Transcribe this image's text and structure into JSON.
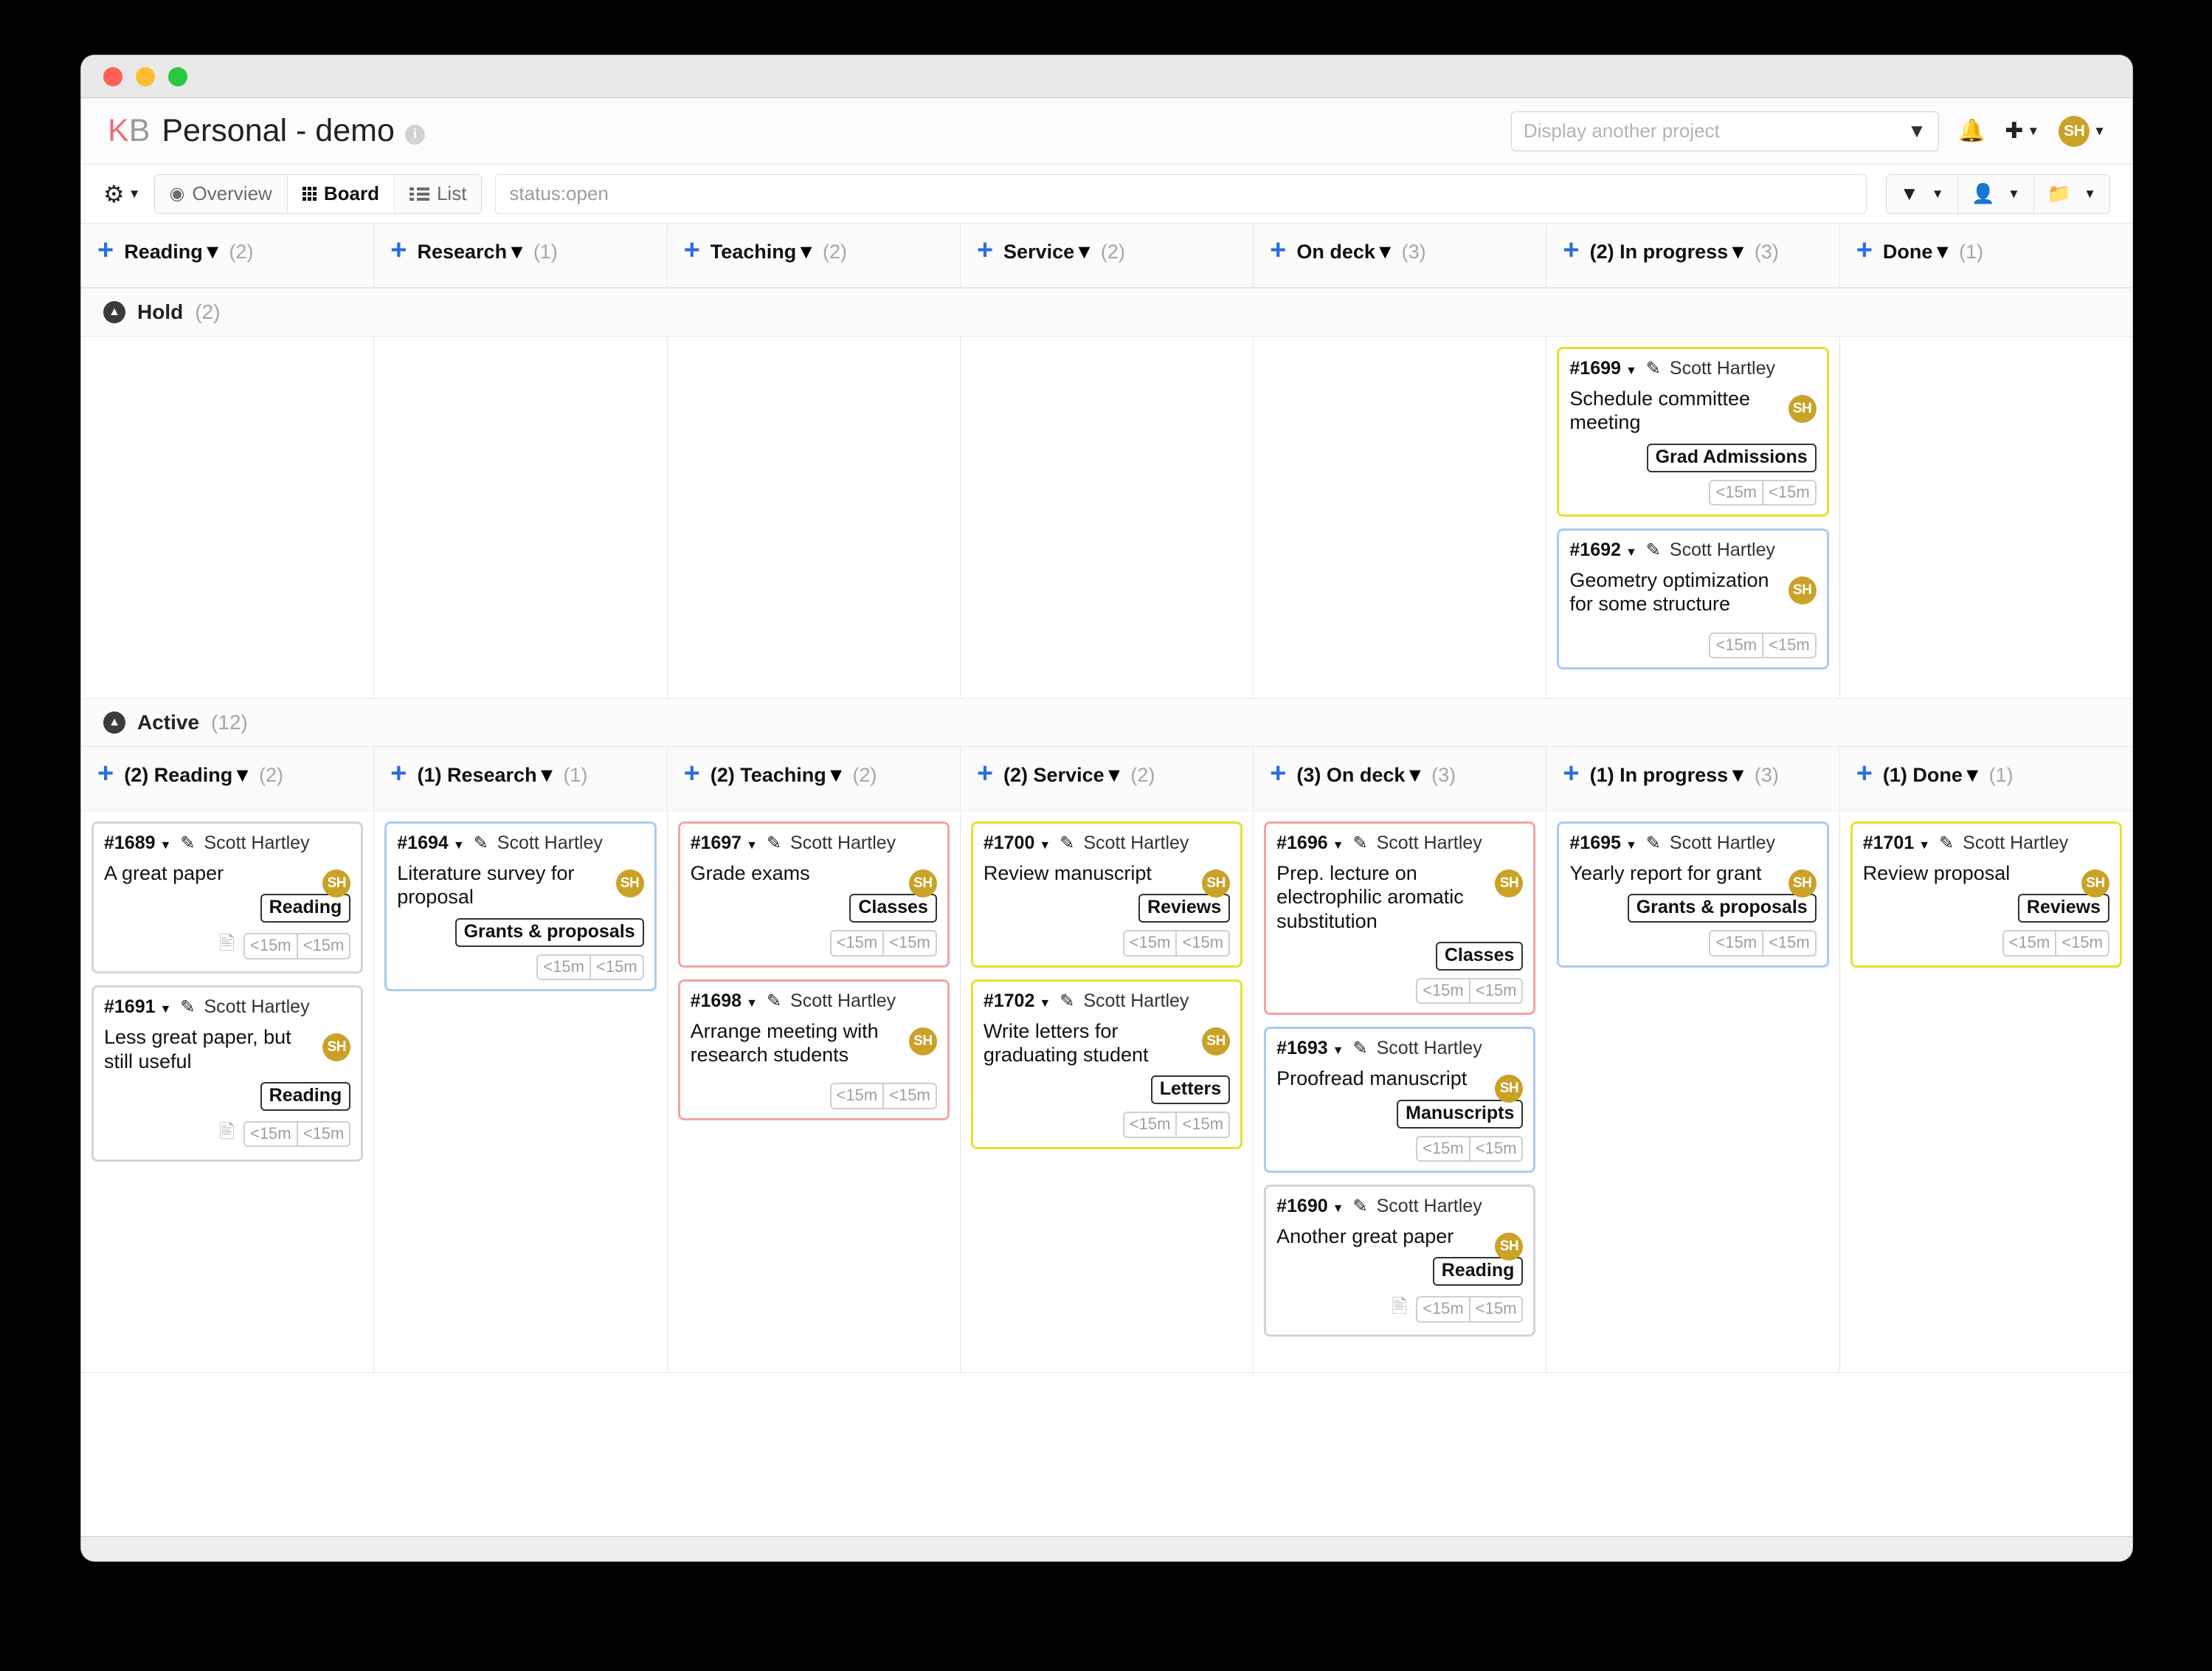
{
  "window": {
    "traffic_lights": [
      "close",
      "minimize",
      "maximize"
    ]
  },
  "header": {
    "brand_k": "K",
    "brand_b": "B",
    "project_title": "Personal - demo",
    "info_icon": "info-icon",
    "project_select_placeholder": "Display another project",
    "project_select_value": "",
    "bell_icon": "bell-icon",
    "plus_icon": "plus-icon",
    "avatar_initials": "SH"
  },
  "toolbar": {
    "gear_label": "⚙",
    "views": [
      {
        "label": "Overview",
        "icon": "eye-icon",
        "active": false
      },
      {
        "label": "Board",
        "icon": "grid-icon",
        "active": true
      },
      {
        "label": "List",
        "icon": "list-icon",
        "active": false
      }
    ],
    "search_value": "status:open",
    "search_placeholder": "status:open",
    "filters": [
      {
        "icon": "funnel-icon",
        "label": ""
      },
      {
        "icon": "user-icon",
        "label": ""
      },
      {
        "icon": "folder-icon",
        "label": ""
      }
    ]
  },
  "board": {
    "columns_top": [
      {
        "title": "Reading",
        "count": "(2)"
      },
      {
        "title": "Research",
        "count": "(1)"
      },
      {
        "title": "Teaching",
        "count": "(2)"
      },
      {
        "title": "Service",
        "count": "(2)"
      },
      {
        "title": "On deck",
        "count": "(3)"
      },
      {
        "title": "(2) In progress",
        "count": "(3)"
      },
      {
        "title": "Done",
        "count": "(1)"
      }
    ],
    "columns_active": [
      {
        "title": "(2) Reading",
        "count": "(2)"
      },
      {
        "title": "(1) Research",
        "count": "(1)"
      },
      {
        "title": "(2) Teaching",
        "count": "(2)"
      },
      {
        "title": "(2) Service",
        "count": "(2)"
      },
      {
        "title": "(3) On deck",
        "count": "(3)"
      },
      {
        "title": "(1) In progress",
        "count": "(3)"
      },
      {
        "title": "(1) Done",
        "count": "(1)"
      }
    ],
    "swimlanes": [
      {
        "name": "Hold",
        "count": "(2)"
      },
      {
        "name": "Active",
        "count": "(12)"
      }
    ],
    "hold": {
      "reading": [],
      "research": [],
      "teaching": [],
      "service": [],
      "ondeck": [],
      "inprogress": [
        {
          "id": "#1699",
          "assignee": "Scott Hartley",
          "avatar": "SH",
          "title": "Schedule committee meeting",
          "category": "Grad Admissions",
          "color": "yellow",
          "has_doc": false,
          "time1": "<15m",
          "time2": "<15m"
        },
        {
          "id": "#1692",
          "assignee": "Scott Hartley",
          "avatar": "SH",
          "title": "Geometry optimization for some structure",
          "category": "",
          "color": "blue",
          "has_doc": false,
          "time1": "<15m",
          "time2": "<15m"
        }
      ],
      "done": []
    },
    "active": {
      "reading": [
        {
          "id": "#1689",
          "assignee": "Scott Hartley",
          "avatar": "SH",
          "title": "A great paper",
          "category": "Reading",
          "color": "grey",
          "has_doc": true,
          "time1": "<15m",
          "time2": "<15m"
        },
        {
          "id": "#1691",
          "assignee": "Scott Hartley",
          "avatar": "SH",
          "title": "Less great paper, but still useful",
          "category": "Reading",
          "color": "grey",
          "has_doc": true,
          "time1": "<15m",
          "time2": "<15m"
        }
      ],
      "research": [
        {
          "id": "#1694",
          "assignee": "Scott Hartley",
          "avatar": "SH",
          "title": "Literature survey for proposal",
          "category": "Grants & proposals",
          "color": "blue",
          "has_doc": false,
          "time1": "<15m",
          "time2": "<15m"
        }
      ],
      "teaching": [
        {
          "id": "#1697",
          "assignee": "Scott Hartley",
          "avatar": "SH",
          "title": "Grade exams",
          "category": "Classes",
          "color": "red",
          "has_doc": false,
          "time1": "<15m",
          "time2": "<15m"
        },
        {
          "id": "#1698",
          "assignee": "Scott Hartley",
          "avatar": "SH",
          "title": "Arrange meeting with research students",
          "category": "",
          "color": "red",
          "has_doc": false,
          "time1": "<15m",
          "time2": "<15m"
        }
      ],
      "service": [
        {
          "id": "#1700",
          "assignee": "Scott Hartley",
          "avatar": "SH",
          "title": "Review manuscript",
          "category": "Reviews",
          "color": "yellow",
          "has_doc": false,
          "time1": "<15m",
          "time2": "<15m"
        },
        {
          "id": "#1702",
          "assignee": "Scott Hartley",
          "avatar": "SH",
          "title": "Write letters for graduating student",
          "category": "Letters",
          "color": "yellow",
          "has_doc": false,
          "time1": "<15m",
          "time2": "<15m"
        }
      ],
      "ondeck": [
        {
          "id": "#1696",
          "assignee": "Scott Hartley",
          "avatar": "SH",
          "title": "Prep. lecture on electrophilic aromatic substitution",
          "category": "Classes",
          "color": "red",
          "has_doc": false,
          "time1": "<15m",
          "time2": "<15m"
        },
        {
          "id": "#1693",
          "assignee": "Scott Hartley",
          "avatar": "SH",
          "title": "Proofread manuscript",
          "category": "Manuscripts",
          "color": "blue",
          "has_doc": false,
          "time1": "<15m",
          "time2": "<15m"
        },
        {
          "id": "#1690",
          "assignee": "Scott Hartley",
          "avatar": "SH",
          "title": "Another great paper",
          "category": "Reading",
          "color": "grey",
          "has_doc": true,
          "time1": "<15m",
          "time2": "<15m"
        }
      ],
      "inprogress": [
        {
          "id": "#1695",
          "assignee": "Scott Hartley",
          "avatar": "SH",
          "title": "Yearly report for grant",
          "category": "Grants & proposals",
          "color": "blue",
          "has_doc": false,
          "time1": "<15m",
          "time2": "<15m"
        }
      ],
      "done": [
        {
          "id": "#1701",
          "assignee": "Scott Hartley",
          "avatar": "SH",
          "title": "Review proposal",
          "category": "Reviews",
          "color": "yellow",
          "has_doc": false,
          "time1": "<15m",
          "time2": "<15m"
        }
      ]
    }
  },
  "colors": {
    "accent_blue": "#2a6ee0",
    "brand_red": "#e8707a",
    "avatar_gold": "#c9a227",
    "card_blue": "#a9cdf0",
    "card_red": "#f4a3a3",
    "card_yellow": "#e3e22c",
    "card_grey": "#d4d4d4"
  }
}
